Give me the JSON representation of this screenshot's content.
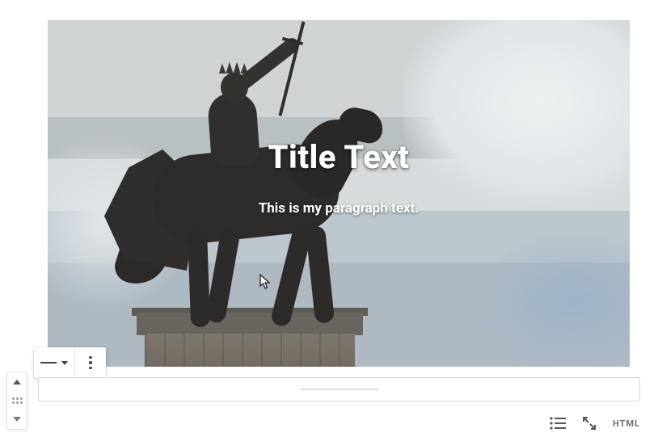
{
  "cover": {
    "title": "Title Text",
    "paragraph": "This is my paragraph text."
  },
  "toolbar": {
    "align_tooltip": "Change alignment",
    "more_tooltip": "More options"
  },
  "mover": {
    "up_tooltip": "Move up",
    "drag_tooltip": "Drag block",
    "down_tooltip": "Move down"
  },
  "view": {
    "list_tooltip": "List view",
    "fullscreen_tooltip": "Fullscreen",
    "html_label": "HTML"
  }
}
